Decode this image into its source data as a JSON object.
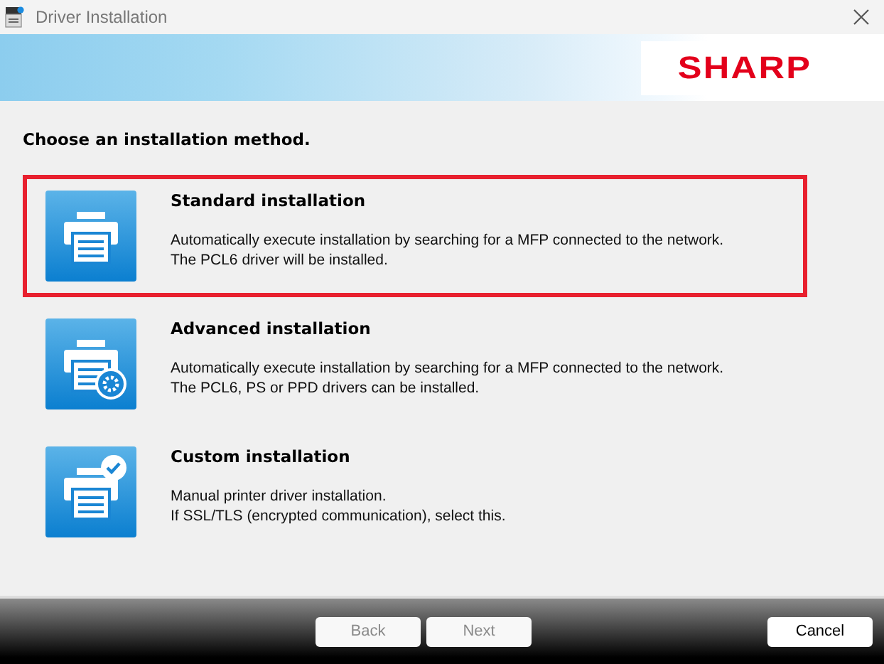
{
  "window": {
    "title": "Driver Installation"
  },
  "banner": {
    "logo": "SHARP"
  },
  "heading": "Choose an installation method.",
  "options": [
    {
      "kind": "standard",
      "title": "Standard installation",
      "lines": [
        "Automatically execute installation by searching for a MFP connected to the network.",
        "The PCL6 driver will be installed."
      ],
      "selected": true
    },
    {
      "kind": "advanced",
      "title": "Advanced installation",
      "lines": [
        "Automatically execute installation by searching for a MFP connected to the network.",
        "The PCL6, PS or PPD drivers can be installed."
      ],
      "selected": false
    },
    {
      "kind": "custom",
      "title": "Custom installation",
      "lines": [
        "Manual printer driver installation.",
        "If SSL/TLS (encrypted communication), select this."
      ],
      "selected": false
    }
  ],
  "buttons": [
    {
      "label": "Back",
      "disabled": true
    },
    {
      "label": "Next",
      "disabled": true
    },
    {
      "label": "Cancel",
      "disabled": false
    }
  ]
}
